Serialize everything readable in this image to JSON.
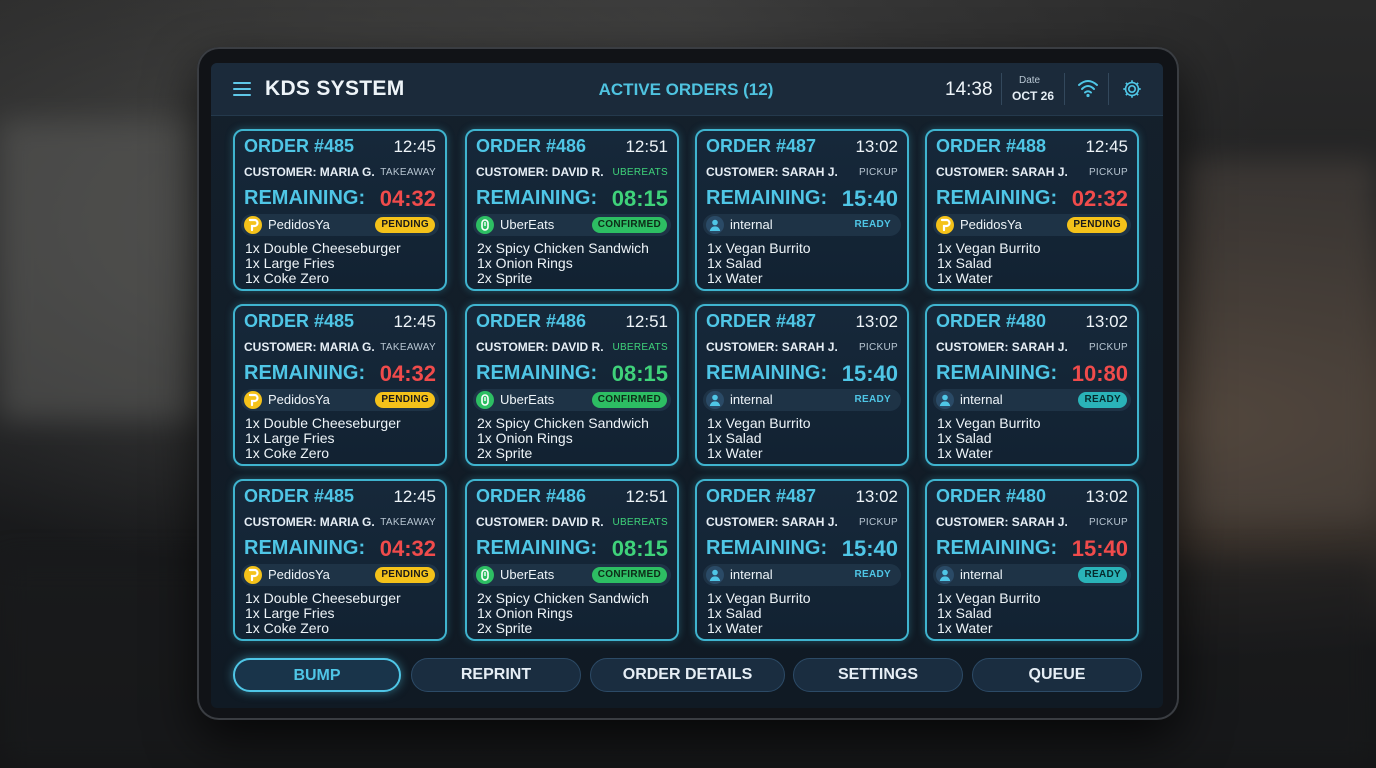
{
  "header": {
    "app_title": "KDS SYSTEM",
    "active_orders": "ACTIVE ORDERS (12)",
    "clock": "14:38",
    "date_label": "Date",
    "date_value": "OCT 26"
  },
  "colors": {
    "accent": "#4fc6e6",
    "timer_red": "#f04b4b",
    "timer_green": "#3fd27a",
    "pending": "#f4c21a",
    "confirmed": "#2dbe63",
    "ready": "#2ab3b8"
  },
  "orders": [
    {
      "order": "ORDER #485",
      "time": "12:45",
      "customer": "CUSTOMER: MARIA G.",
      "type": "TAKEAWAY",
      "remaining_label": "REMAINING:",
      "remaining": "04:32",
      "timer_color": "red",
      "source": "PedidosYa",
      "source_icon": "pedidosya-icon",
      "status": "PENDING",
      "items": [
        "1x Double Cheeseburger",
        "1x Large Fries",
        "1x Coke Zero"
      ]
    },
    {
      "order": "ORDER #486",
      "time": "12:51",
      "customer": "CUSTOMER: DAVID R.",
      "type": "UBEREATS",
      "remaining_label": "REMAINING:",
      "remaining": "08:15",
      "timer_color": "green",
      "source": "UberEats",
      "source_icon": "ubereats-icon",
      "status": "CONFIRMED",
      "items": [
        "2x Spicy Chicken Sandwich",
        "1x Onion Rings",
        "2x Sprite"
      ]
    },
    {
      "order": "ORDER #487",
      "time": "13:02",
      "customer": "CUSTOMER: SARAH J.",
      "type": "PICKUP",
      "remaining_label": "REMAINING:",
      "remaining": "15:40",
      "timer_color": "blue",
      "source": "internal",
      "source_icon": "user-icon",
      "status": "READY",
      "items": [
        "1x Vegan Burrito",
        "1x Salad",
        "1x Water"
      ]
    },
    {
      "order": "ORDER #488",
      "time": "12:45",
      "customer": "CUSTOMER: SARAH J.",
      "type": "PICKUP",
      "remaining_label": "REMAINING:",
      "remaining": "02:32",
      "timer_color": "red",
      "source": "PedidosYa",
      "source_icon": "pedidosya-icon",
      "status": "PENDING",
      "items": [
        "1x Vegan Burrito",
        "1x Salad",
        "1x Water"
      ]
    },
    {
      "order": "ORDER #485",
      "time": "12:45",
      "customer": "CUSTOMER: MARIA G.",
      "type": "TAKEAWAY",
      "remaining_label": "REMAINING:",
      "remaining": "04:32",
      "timer_color": "red",
      "source": "PedidosYa",
      "source_icon": "pedidosya-icon",
      "status": "PENDING",
      "items": [
        "1x Double Cheeseburger",
        "1x Large Fries",
        "1x Coke Zero"
      ]
    },
    {
      "order": "ORDER #486",
      "time": "12:51",
      "customer": "CUSTOMER: DAVID R.",
      "type": "UBEREATS",
      "remaining_label": "REMAINING:",
      "remaining": "08:15",
      "timer_color": "green",
      "source": "UberEats",
      "source_icon": "ubereats-icon",
      "status": "CONFIRMED",
      "items": [
        "2x Spicy Chicken Sandwich",
        "1x Onion Rings",
        "2x Sprite"
      ]
    },
    {
      "order": "ORDER #487",
      "time": "13:02",
      "customer": "CUSTOMER: SARAH J.",
      "type": "PICKUP",
      "remaining_label": "REMAINING:",
      "remaining": "15:40",
      "timer_color": "blue",
      "source": "internal",
      "source_icon": "user-icon",
      "status": "READY",
      "items": [
        "1x Vegan Burrito",
        "1x Salad",
        "1x Water"
      ]
    },
    {
      "order": "ORDER #480",
      "time": "13:02",
      "customer": "CUSTOMER: SARAH J.",
      "type": "PICKUP",
      "remaining_label": "REMAINING:",
      "remaining": "10:80",
      "timer_color": "red",
      "source": "internal",
      "source_icon": "user-icon",
      "status": "READY",
      "items": [
        "1x Vegan Burrito",
        "1x Salad",
        "1x Water"
      ]
    },
    {
      "order": "ORDER #485",
      "time": "12:45",
      "customer": "CUSTOMER: MARIA G.",
      "type": "TAKEAWAY",
      "remaining_label": "REMAINING:",
      "remaining": "04:32",
      "timer_color": "red",
      "source": "PedidosYa",
      "source_icon": "pedidosya-icon",
      "status": "PENDING",
      "items": [
        "1x Double Cheeseburger",
        "1x Large Fries",
        "1x Coke Zero"
      ]
    },
    {
      "order": "ORDER #486",
      "time": "12:51",
      "customer": "CUSTOMER: DAVID R.",
      "type": "UBEREATS",
      "remaining_label": "REMAINING:",
      "remaining": "08:15",
      "timer_color": "green",
      "source": "UberEats",
      "source_icon": "ubereats-icon",
      "status": "CONFIRMED",
      "items": [
        "2x Spicy Chicken Sandwich",
        "1x Onion Rings",
        "2x Sprite"
      ]
    },
    {
      "order": "ORDER #487",
      "time": "13:02",
      "customer": "CUSTOMER: SARAH J.",
      "type": "PICKUP",
      "remaining_label": "REMAINING:",
      "remaining": "15:40",
      "timer_color": "blue",
      "source": "internal",
      "source_icon": "user-icon",
      "status": "READY",
      "items": [
        "1x Vegan Burrito",
        "1x Salad",
        "1x Water"
      ]
    },
    {
      "order": "ORDER #480",
      "time": "13:02",
      "customer": "CUSTOMER: SARAH J.",
      "type": "PICKUP",
      "remaining_label": "REMAINING:",
      "remaining": "15:40",
      "timer_color": "red",
      "source": "internal",
      "source_icon": "user-icon",
      "status": "READY",
      "items": [
        "1x Vegan Burrito",
        "1x Salad",
        "1x Water"
      ]
    }
  ],
  "buttons": {
    "bump": "BUMP",
    "reprint": "REPRINT",
    "order_details": "ORDER DETAILS",
    "settings": "SETTINGS",
    "queue": "QUEUE"
  }
}
